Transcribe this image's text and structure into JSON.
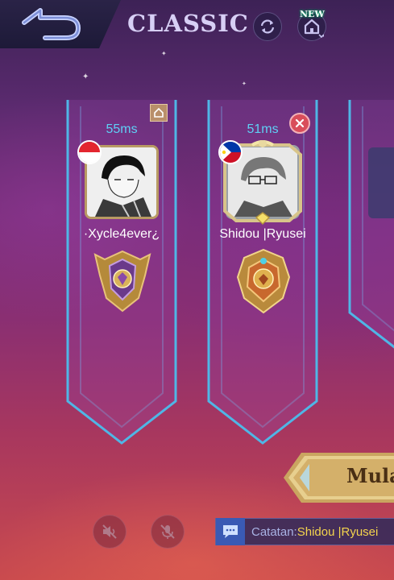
{
  "header": {
    "mode_title": "CLASSIC",
    "new_badge": "NEW"
  },
  "players": [
    {
      "ping": "55ms",
      "name": "·Xycle4ever¿",
      "flag": "indonesia",
      "is_host": true
    },
    {
      "ping": "51ms",
      "name": "Shidou |Ryusei",
      "flag": "philippines",
      "is_host": false
    }
  ],
  "start_button": {
    "label": "Mula"
  },
  "note": {
    "label": "Catatan:",
    "value": "Shidou |Ryusei"
  },
  "icons": [
    "back-arrow-icon",
    "refresh-icon",
    "home-icon",
    "host-home-icon",
    "close-icon",
    "speaker-muted-icon",
    "mic-muted-icon",
    "chat-icon"
  ],
  "colors": {
    "ping": "#5fd0f5",
    "title": "#d7cff5",
    "note_value": "#f4d44d",
    "banner_edge": "#4fb6e6"
  }
}
